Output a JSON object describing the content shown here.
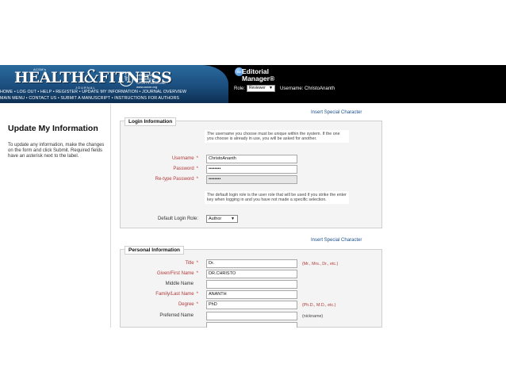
{
  "header": {
    "acsm_label": "ACSM's",
    "logo_left": "HEALTH",
    "logo_amp": "&",
    "logo_right": "FITNESS",
    "journal_label": "JOURNAL",
    "acsm_org": "AMERICAN COLLEGE of SPORTS MEDICINE · www.acsm.org",
    "nav_row1": [
      "HOME",
      "LOG OUT",
      "HELP",
      "REGISTER",
      "UPDATE MY INFORMATION",
      "JOURNAL OVERVIEW"
    ],
    "nav_row2": [
      "MAIN MENU",
      "CONTACT US",
      "SUBMIT A MANUSCRIPT",
      "INSTRUCTIONS FOR AUTHORS"
    ],
    "em_badge": "em",
    "em_title_line1": "Editorial",
    "em_title_line2": "Manager®",
    "role_label": "Role:",
    "role_value": "Reviewer",
    "username_text": "Username: ChristoAnanth"
  },
  "sidebar": {
    "title": "Update My Information",
    "instructions": "To update any information, make the changes on the form and click Submit. Required fields have an asterisk next to the label."
  },
  "login": {
    "insert_special": "Insert Special Character",
    "legend": "Login Information",
    "note_unique": "The username you choose must be unique within the system. If the one you choose is already in use, you will be asked for another.",
    "username_label": "Username",
    "username_value": "ChristoAnanth",
    "password_label": "Password",
    "password_value": "••••••••",
    "retype_label": "Re-type Password",
    "retype_value": "••••••••",
    "note_role": "The default login role is the user role that will be used if you strike the enter key when logging in and you have not made a specific selection.",
    "default_role_label": "Default Login Role:",
    "default_role_value": "Author"
  },
  "personal": {
    "insert_special": "Insert Special Character",
    "legend": "Personal Information",
    "title_label": "Title",
    "title_value": "Dr.",
    "title_hint": "(Mr., Mrs., Dr., etc.)",
    "given_label": "Given/First Name",
    "given_value": "DR.CHRISTO",
    "middle_label": "Middle Name",
    "middle_value": "",
    "family_label": "Family/Last Name",
    "family_value": "ANANTH",
    "degree_label": "Degree",
    "degree_value": "PhD",
    "degree_hint": "(Ph.D., M.D., etc.)",
    "preferred_label": "Preferred Name",
    "preferred_value": "",
    "preferred_hint": "(nickname)",
    "asterisk": "*"
  },
  "colors": {
    "header_bg": "#000000",
    "header_blue": "#1b4e7e",
    "required_label": "#b23a3a",
    "link": "#1a4f8c"
  }
}
